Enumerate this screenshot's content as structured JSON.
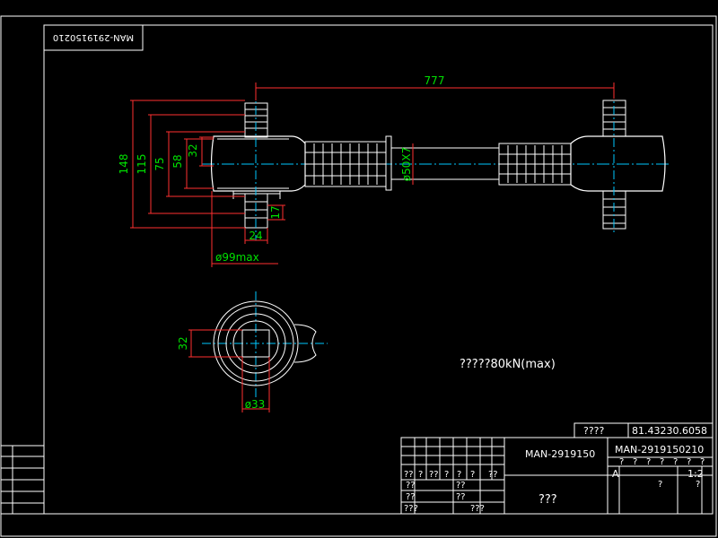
{
  "stamp": {
    "top_left": "MAN-2919150210"
  },
  "dimensions": {
    "length": "777",
    "h148": "148",
    "h115": "115",
    "h75": "75",
    "h58": "58",
    "h32": "32",
    "w17": "17",
    "w24": "24",
    "dia99": "ø99max",
    "bar": "ø50X7",
    "end_32": "32",
    "end_dia33": "ø33"
  },
  "note": "?????80kN(max)",
  "title_block": {
    "label_left": "????",
    "code": "81.43230.6058",
    "part": "MAN-2919150",
    "part2": "MAN-2919150210",
    "name": "???",
    "scale": "1:2",
    "sheet_mark": "A",
    "qmarks": {
      "h1": "??",
      "h2": "?",
      "h3": "??",
      "h4": "?",
      "h5": "?",
      "h6": "?",
      "h7": "??",
      "r1": "??",
      "r2": "??",
      "r3": "???",
      "m1": "??",
      "m2": "??",
      "b1": "???",
      "s1": "?",
      "s2": "?",
      "s3": "?",
      "s4": "?",
      "s5": "?",
      "s6": "?",
      "s7": "?",
      "t1": "?",
      "t2": "?"
    }
  },
  "colors": {
    "outline": "#ffffff",
    "dimension": "#ff3030",
    "dim_text": "#00e000",
    "center": "#00c8ff"
  }
}
